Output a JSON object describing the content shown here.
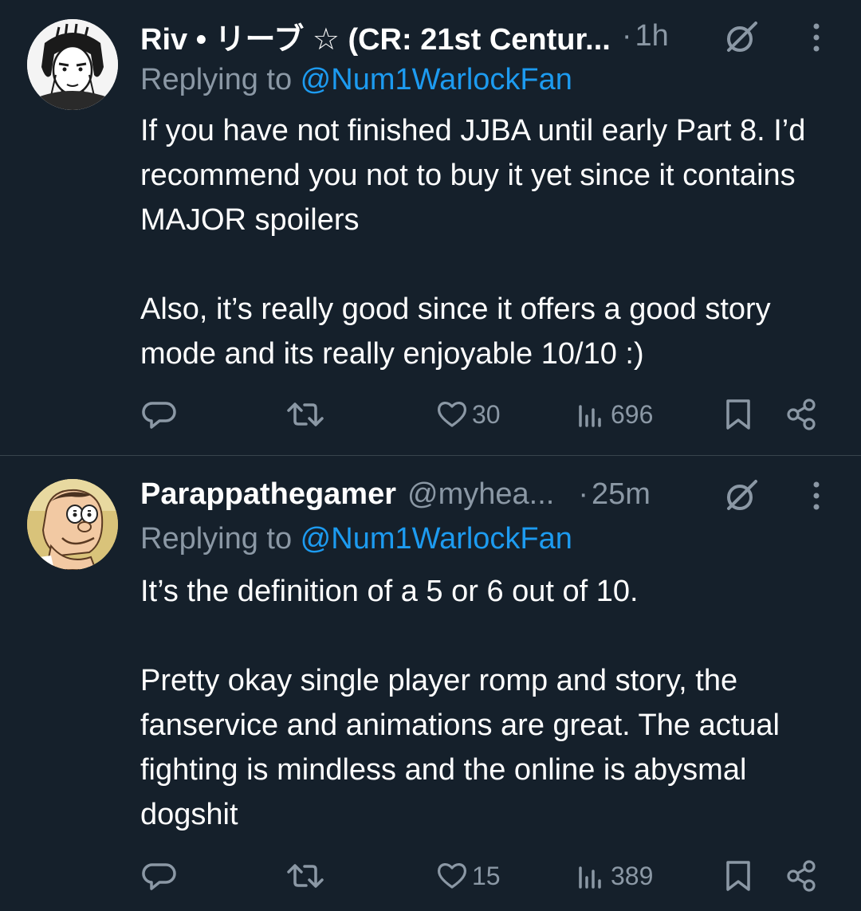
{
  "tweets": [
    {
      "display_name": "Riv • リーブ ☆ (CR: 21st Centur...",
      "handle": "",
      "dot": "·",
      "time": "1h",
      "replying_prefix": "Replying to ",
      "replying_to": "@Num1WarlockFan",
      "paragraphs": [
        "If you have not finished JJBA until early Part 8. I’d recommend you not to buy it yet since it contains MAJOR spoilers",
        "Also, it’s really good since it offers a good story mode and its really enjoyable 10/10 :)"
      ],
      "likes": "30",
      "views": "696",
      "avatar_icon": "manga-character-avatar"
    },
    {
      "display_name": "Parappathegamer",
      "handle": "@myhea...",
      "dot": "·",
      "time": "25m",
      "replying_prefix": "Replying to ",
      "replying_to": "@Num1WarlockFan",
      "paragraphs": [
        "It’s the definition of a 5 or 6 out of 10.",
        "Pretty okay single player romp and story, the fanservice and animations are great. The actual fighting is mindless and the online is abysmal dogshit"
      ],
      "likes": "15",
      "views": "389",
      "avatar_icon": "cartoon-man-avatar"
    }
  ],
  "colors": {
    "background": "#15202b",
    "text": "#ffffff",
    "secondary": "#8b98a5",
    "link": "#1d9bf0",
    "divider": "#38444d"
  },
  "icons": [
    "reply-icon",
    "retweet-icon",
    "like-icon",
    "views-icon",
    "bookmark-icon",
    "share-icon",
    "grok-icon",
    "more-icon"
  ]
}
